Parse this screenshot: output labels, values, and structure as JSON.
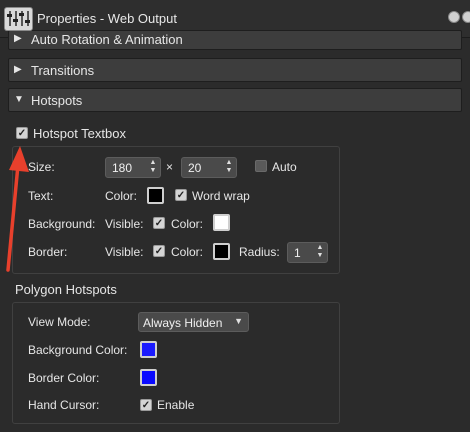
{
  "window": {
    "title": "Properties - Web Output"
  },
  "sections": [
    {
      "label": "Auto Rotation & Animation",
      "expanded": false
    },
    {
      "label": "Transitions",
      "expanded": false
    },
    {
      "label": "Hotspots",
      "expanded": true
    }
  ],
  "hotspot_textbox": {
    "checkbox_label": "Hotspot Textbox",
    "checked": true,
    "size_label": "Size:",
    "width": "180",
    "times": "×",
    "height": "20",
    "auto_label": "Auto",
    "text_label": "Text:",
    "color_label": "Color:",
    "text_color": "#000000",
    "word_wrap_label": "Word wrap",
    "background_label": "Background:",
    "visible_label": "Visible:",
    "background_color": "#ffffff",
    "border_label": "Border:",
    "border_color": "#000000",
    "radius_label": "Radius:",
    "radius": "1"
  },
  "polygon_hotspots": {
    "heading": "Polygon Hotspots",
    "view_mode_label": "View Mode:",
    "view_mode_value": "Always Hidden",
    "background_color_label": "Background Color:",
    "background_color": "#1a1aff",
    "border_color_label": "Border Color:",
    "border_color": "#0a0aff",
    "hand_cursor_label": "Hand Cursor:",
    "enable_label": "Enable"
  },
  "annotation": {
    "arrow_color": "#e8402c"
  }
}
